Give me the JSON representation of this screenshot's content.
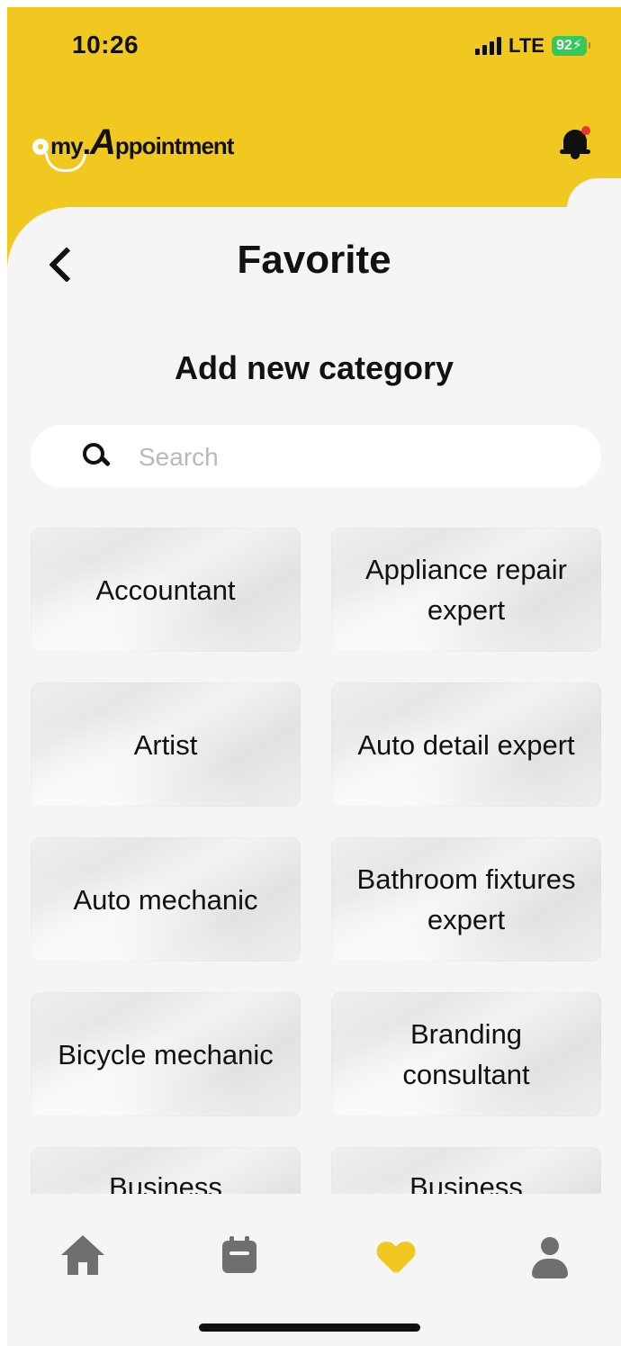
{
  "status_bar": {
    "time": "10:26",
    "network": "LTE",
    "battery": "92"
  },
  "app": {
    "logo_prefix": "my",
    "logo_initial": "A",
    "logo_rest": "ppointment"
  },
  "page": {
    "title": "Favorite",
    "subtitle": "Add new category"
  },
  "search": {
    "placeholder": "Search",
    "value": ""
  },
  "categories": [
    "Accountant",
    "Appliance repair expert",
    "Artist",
    "Auto detail expert",
    "Auto mechanic",
    "Bathroom fixtures expert",
    "Bicycle mechanic",
    "Branding consultant",
    "Business",
    "Business"
  ],
  "tabbar": {
    "items": [
      {
        "icon": "home-icon",
        "active": false
      },
      {
        "icon": "calendar-icon",
        "active": false
      },
      {
        "icon": "heart-icon",
        "active": true
      },
      {
        "icon": "profile-icon",
        "active": false
      }
    ]
  },
  "colors": {
    "brand": "#f1c81f",
    "notification_dot": "#e53935",
    "inactive_icon": "#6f6f6f"
  }
}
